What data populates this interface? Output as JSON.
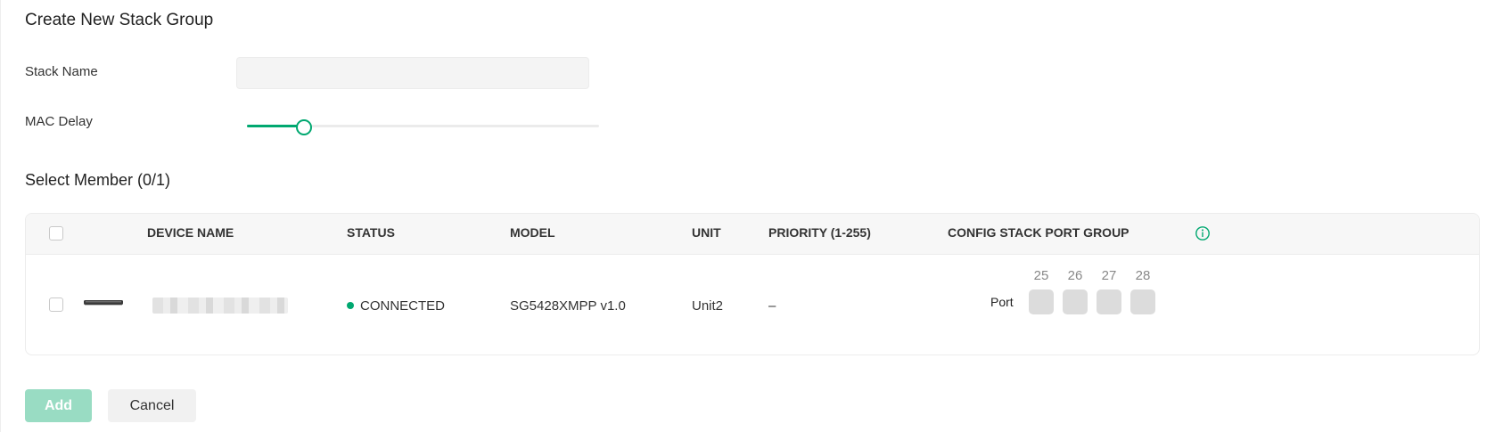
{
  "form": {
    "title": "Create New Stack Group",
    "stack_name": {
      "label": "Stack Name",
      "value": "",
      "placeholder": ""
    },
    "mac_delay": {
      "label": "MAC Delay",
      "value_fraction": 0.16
    }
  },
  "members": {
    "title": "Select Member (0/1)",
    "columns": {
      "device_name": "DEVICE NAME",
      "status": "STATUS",
      "model": "MODEL",
      "unit": "UNIT",
      "priority": "PRIORITY (1-255)",
      "config_stack_port_group": "CONFIG STACK PORT GROUP"
    },
    "rows": [
      {
        "device_name": "",
        "status": "CONNECTED",
        "model": "SG5428XMPP v1.0",
        "unit": "Unit2",
        "priority": "–",
        "port_label": "Port",
        "ports": [
          "25",
          "26",
          "27",
          "28"
        ]
      }
    ]
  },
  "actions": {
    "add_label": "Add",
    "cancel_label": "Cancel"
  },
  "colors": {
    "accent": "#00a870",
    "accent_disabled": "#99dcc3",
    "status_connected": "#00a870"
  },
  "icons": {
    "info": "info-circle-icon",
    "device": "switch-device-icon"
  }
}
